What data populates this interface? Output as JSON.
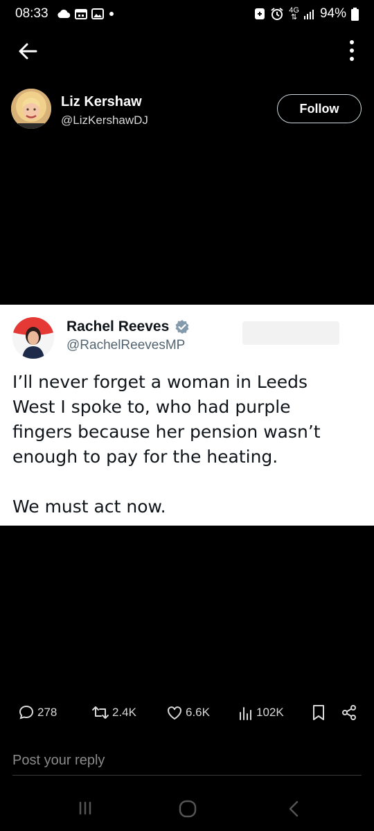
{
  "status_bar": {
    "time": "08:33",
    "network": "4G",
    "battery": "94%",
    "left_icons": [
      "cloud-icon",
      "calendar-icon",
      "gallery-icon",
      "dot-icon"
    ],
    "right_icons": [
      "vpn-icon",
      "alarm-icon",
      "signal-icon",
      "battery-icon"
    ]
  },
  "header": {
    "back_icon": "arrow-left-icon",
    "more_icon": "more-vertical-icon"
  },
  "author": {
    "name": "Liz Kershaw",
    "handle": "@LizKershawDJ",
    "follow_label": "Follow"
  },
  "embedded_post": {
    "name": "Rachel Reeves",
    "verified": true,
    "handle": "@RachelReevesMP",
    "paragraphs": [
      "I’ll never forget a woman in Leeds West I spoke to, who had purple fingers because her pension wasn’t enough to pay for the heating.",
      "We must act now."
    ]
  },
  "actions": {
    "replies": "278",
    "reposts": "2.4K",
    "likes": "6.6K",
    "views": "102K"
  },
  "reply_box": {
    "placeholder": "Post your reply"
  },
  "colors": {
    "background": "#000000",
    "card_background": "#ffffff",
    "verified_badge": "#829aab",
    "text_primary": "#e7e9ea"
  }
}
